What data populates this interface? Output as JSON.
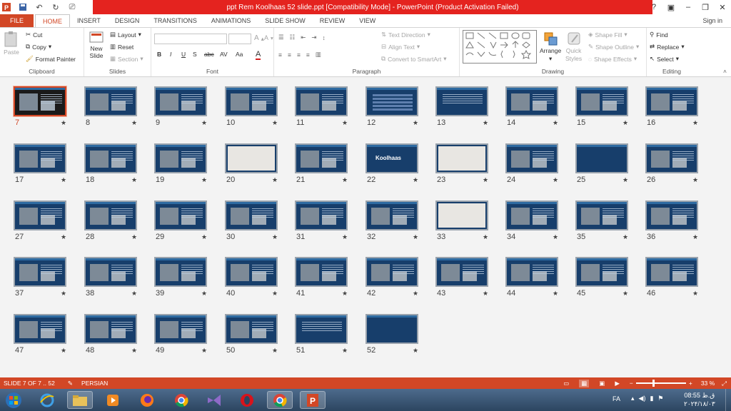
{
  "window": {
    "title": "ppt Rem Koolhaas 52 slide.ppt [Compatibility Mode] - PowerPoint (Product Activation Failed)",
    "help": "?",
    "sign_in": "Sign in"
  },
  "tabs": [
    "FILE",
    "HOME",
    "INSERT",
    "DESIGN",
    "TRANSITIONS",
    "ANIMATIONS",
    "SLIDE SHOW",
    "REVIEW",
    "VIEW"
  ],
  "active_tab": "HOME",
  "ribbon": {
    "clipboard": {
      "label": "Clipboard",
      "paste": "Paste",
      "cut": "Cut",
      "copy": "Copy",
      "format_painter": "Format Painter"
    },
    "slides": {
      "label": "Slides",
      "new_slide": "New",
      "new_slide2": "Slide",
      "layout": "Layout",
      "reset": "Reset",
      "section": "Section"
    },
    "font": {
      "label": "Font",
      "bold": "B",
      "italic": "I",
      "underline": "U",
      "shadow": "S",
      "strike": "abc",
      "spacing": "AV",
      "case": "Aa",
      "color": "A"
    },
    "paragraph": {
      "label": "Paragraph",
      "text_direction": "Text Direction",
      "align_text": "Align Text",
      "convert_smartart": "Convert to SmartArt"
    },
    "drawing": {
      "label": "Drawing",
      "arrange": "Arrange",
      "quick": "Quick",
      "styles": "Styles",
      "shape_fill": "Shape Fill",
      "shape_outline": "Shape Outline",
      "shape_effects": "Shape Effects"
    },
    "editing": {
      "label": "Editing",
      "find": "Find",
      "replace": "Replace",
      "select": "Select"
    }
  },
  "slides": [
    {
      "n": "7",
      "style": "portrait",
      "selected": true
    },
    {
      "n": "8",
      "style": "photo"
    },
    {
      "n": "9",
      "style": "photo"
    },
    {
      "n": "10",
      "style": "photo"
    },
    {
      "n": "11",
      "style": "photo"
    },
    {
      "n": "12",
      "style": "stripes"
    },
    {
      "n": "13",
      "style": "text"
    },
    {
      "n": "14",
      "style": "photo"
    },
    {
      "n": "15",
      "style": "photo"
    },
    {
      "n": "16",
      "style": "photo"
    },
    {
      "n": "17",
      "style": "photo"
    },
    {
      "n": "18",
      "style": "photo"
    },
    {
      "n": "19",
      "style": "photo"
    },
    {
      "n": "20",
      "style": "light"
    },
    {
      "n": "21",
      "style": "photo"
    },
    {
      "n": "22",
      "style": "title"
    },
    {
      "n": "23",
      "style": "light"
    },
    {
      "n": "24",
      "style": "photo"
    },
    {
      "n": "25",
      "style": "empty"
    },
    {
      "n": "26",
      "style": "photo"
    },
    {
      "n": "27",
      "style": "photo"
    },
    {
      "n": "28",
      "style": "photo"
    },
    {
      "n": "29",
      "style": "photo"
    },
    {
      "n": "30",
      "style": "photo"
    },
    {
      "n": "31",
      "style": "photo"
    },
    {
      "n": "32",
      "style": "photo"
    },
    {
      "n": "33",
      "style": "light"
    },
    {
      "n": "34",
      "style": "photo"
    },
    {
      "n": "35",
      "style": "photo"
    },
    {
      "n": "36",
      "style": "photo"
    },
    {
      "n": "37",
      "style": "photo"
    },
    {
      "n": "38",
      "style": "photo"
    },
    {
      "n": "39",
      "style": "photo"
    },
    {
      "n": "40",
      "style": "photo"
    },
    {
      "n": "41",
      "style": "photo"
    },
    {
      "n": "42",
      "style": "photo"
    },
    {
      "n": "43",
      "style": "photo"
    },
    {
      "n": "44",
      "style": "photo"
    },
    {
      "n": "45",
      "style": "photo"
    },
    {
      "n": "46",
      "style": "photo"
    },
    {
      "n": "47",
      "style": "photo"
    },
    {
      "n": "48",
      "style": "photo"
    },
    {
      "n": "49",
      "style": "photo"
    },
    {
      "n": "50",
      "style": "photo"
    },
    {
      "n": "51",
      "style": "text"
    },
    {
      "n": "52",
      "style": "empty"
    }
  ],
  "slide22_title": "Koolhaas",
  "status": {
    "slide": "SLIDE 7 OF 7 .. 52",
    "language": "PERSIAN",
    "zoom": "33 %",
    "zoom_level": 0.33
  },
  "taskbar": {
    "lang": "FA",
    "time": "08:55 ق.ظ",
    "date": "۲۰۲۴/۱۸/۰۳"
  }
}
